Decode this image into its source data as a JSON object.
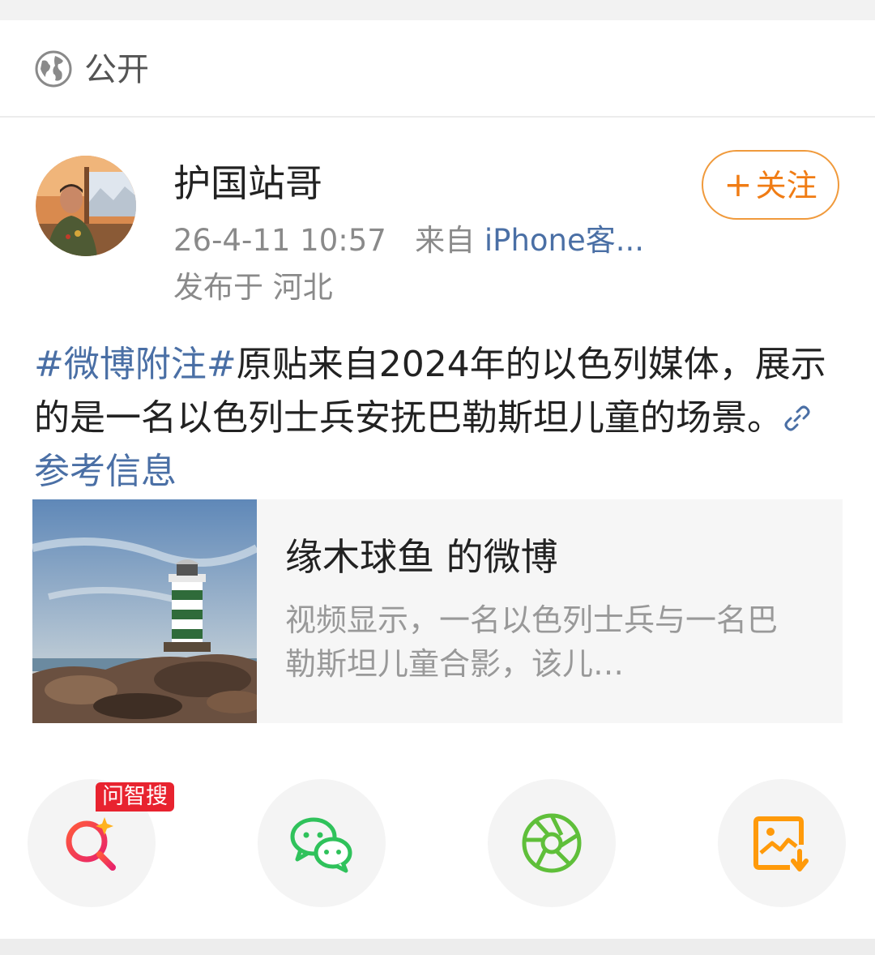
{
  "visibility": {
    "label": "公开",
    "icon": "globe-icon"
  },
  "author": {
    "name": "护国站哥",
    "time": "26-4-11 10:57",
    "source_prefix": "来自",
    "source": "iPhone客...",
    "location": "发布于 河北",
    "follow_label": "关注"
  },
  "post": {
    "hashtag": "#微博附注#",
    "text": "原贴来自2024年的以色列媒体，展示的是一名以色列士兵安抚巴勒斯坦儿童的场景。",
    "link_label": "参考信息"
  },
  "repost": {
    "title": "缘木球鱼 的微博",
    "desc": "视频显示，一名以色列士兵与一名巴勒斯坦儿童合影，该儿…"
  },
  "actions": {
    "badge": "问智搜",
    "items": [
      "ai-search-icon",
      "wechat-icon",
      "moments-icon",
      "save-image-icon"
    ]
  },
  "colors": {
    "link": "#4a6fa5",
    "follow": "#f07c14",
    "badge": "#e8232f"
  }
}
